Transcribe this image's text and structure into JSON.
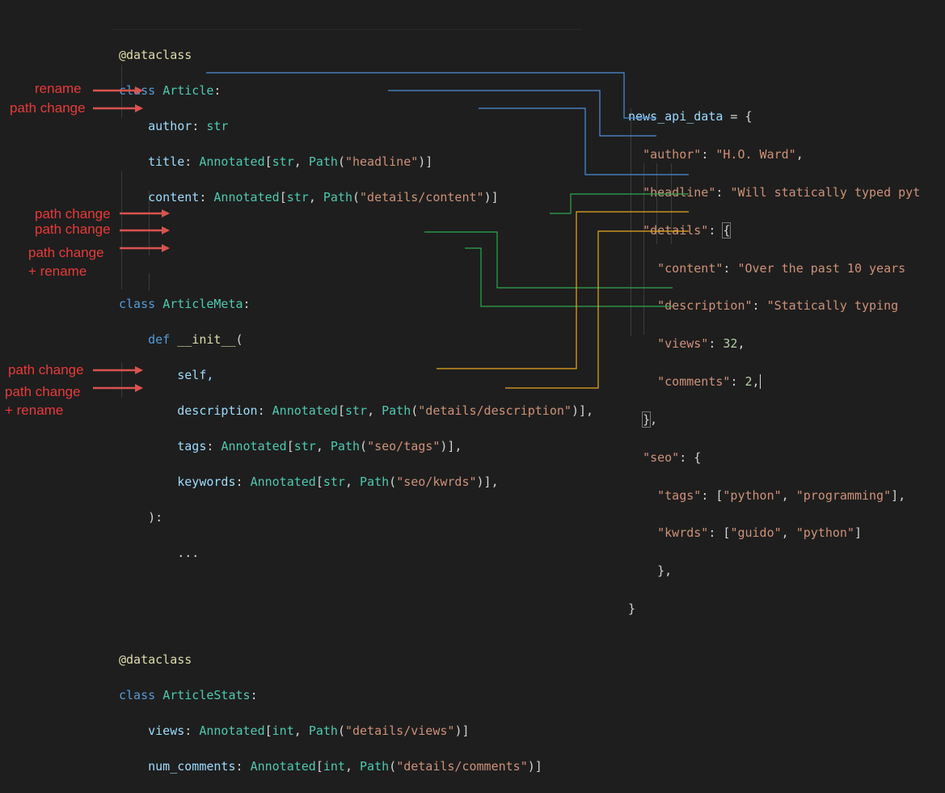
{
  "left_code": {
    "block1": {
      "decorator": "@dataclass",
      "class_kw": "class",
      "class_name": "Article",
      "author_field": "author",
      "author_type": "str",
      "title_field": "title",
      "annotated": "Annotated",
      "str_type": "str",
      "int_type": "int",
      "path_fn": "Path",
      "title_path": "\"headline\"",
      "content_field": "content",
      "content_path": "\"details/content\""
    },
    "block2": {
      "class_kw": "class",
      "class_name": "ArticleMeta",
      "def_kw": "def",
      "init_name": "__init__",
      "self_param": "self,",
      "description_field": "description",
      "description_path": "\"details/description\"",
      "tags_field": "tags",
      "tags_path": "\"seo/tags\"",
      "keywords_field": "keywords",
      "keywords_path": "\"seo/kwrds\"",
      "close_paren": "):",
      "ellipsis": "..."
    },
    "block3": {
      "decorator": "@dataclass",
      "class_kw": "class",
      "class_name": "ArticleStats",
      "views_field": "views",
      "views_path": "\"details/views\"",
      "comments_field": "num_comments",
      "comments_path": "\"details/comments\""
    }
  },
  "annotations": {
    "rename": "rename",
    "path_change": "path change",
    "plus_rename": "+ rename"
  },
  "right_code": {
    "var_name": "news_api_data",
    "assign": " = {",
    "author_key": "\"author\"",
    "author_val": "\"H.O. Ward\"",
    "headline_key": "\"headline\"",
    "headline_val": "\"Will statically typed pyt",
    "details_key": "\"details\"",
    "content_key": "\"content\"",
    "content_val": "\"Over the past 10 years",
    "description_key": "\"description\"",
    "description_val": "\"Statically typing",
    "views_key": "\"views\"",
    "views_val": "32",
    "comments_key": "\"comments\"",
    "comments_val": "2",
    "seo_key": "\"seo\"",
    "tags_key": "\"tags\"",
    "tags_val1": "\"python\"",
    "tags_val2": "\"programming\"",
    "kwrds_key": "\"kwrds\"",
    "kwrds_val1": "\"guido\"",
    "kwrds_val2": "\"python\""
  },
  "colors": {
    "author_line": "#4f8ed8",
    "content_line": "#4f8ed8",
    "headline_line": "#4f8ed8",
    "green_line": "#2fa84f",
    "yellow_line": "#e8a820",
    "arrow": "#d9534f"
  }
}
